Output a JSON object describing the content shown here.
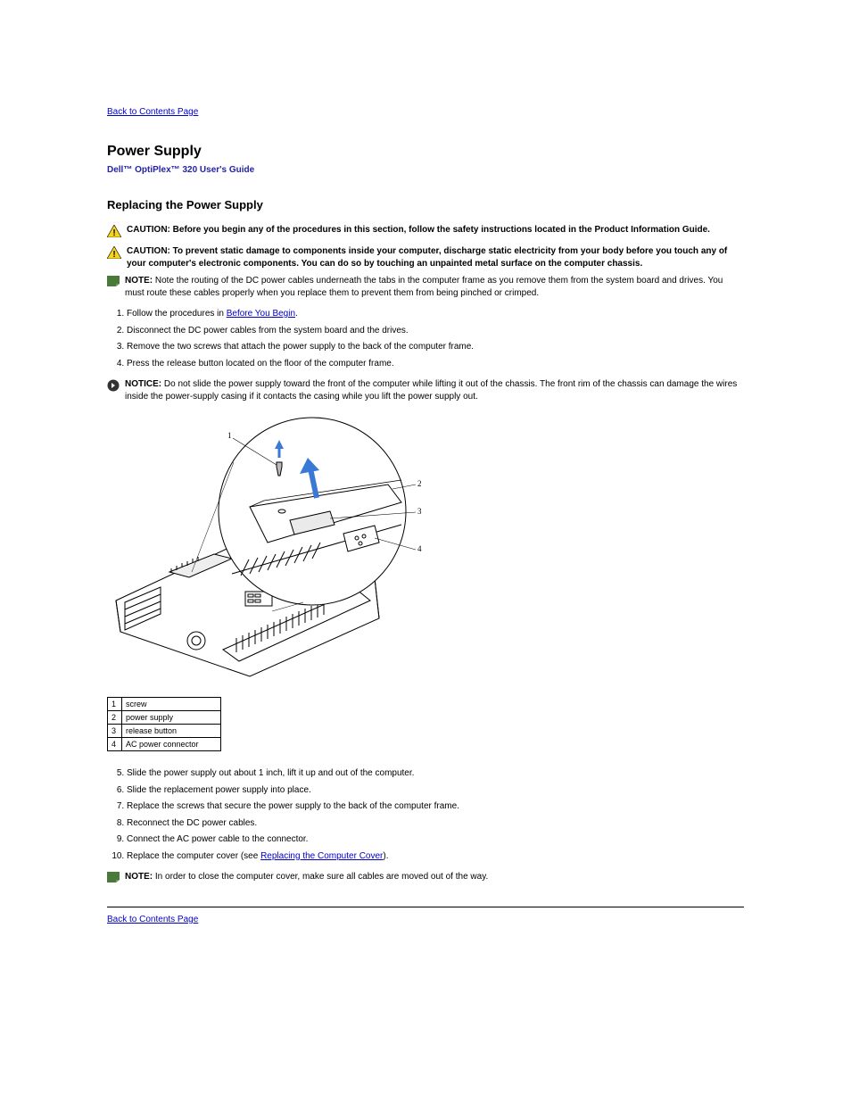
{
  "nav": {
    "back_top": "Back to Contents Page",
    "back_bottom": "Back to Contents Page"
  },
  "title": "Power Supply",
  "subtitle": "Dell™ OptiPlex™ 320 User's Guide",
  "replace": {
    "heading": "Replacing the Power Supply",
    "caution1": "CAUTION: Before you begin any of the procedures in this section, follow the safety instructions located in the Product Information Guide.",
    "caution2": "CAUTION: To prevent static damage to components inside your computer, discharge static electricity from your body before you touch any of your computer's electronic components. You can do so by touching an unpainted metal surface on the computer chassis.",
    "note1": "NOTE: Note the routing of the DC power cables underneath the tabs in the computer frame as you remove them from the system board and drives. You must route these cables properly when you replace them to prevent them from being pinched or crimped.",
    "steps_a": [
      {
        "text_before": "Follow the procedures in ",
        "link": "Before You Begin",
        "text_after": "."
      },
      {
        "text_before": "Disconnect the DC power cables from the system board and the drives."
      },
      {
        "text_before": "Remove the two screws that attach the power supply to the back of the computer frame."
      },
      {
        "text_before": "Press the release button located on the floor of the computer frame."
      }
    ],
    "notice1": "NOTICE: Do not slide the power supply toward the front of the computer while lifting it out of the chassis. The front rim of the chassis can damage the wires inside the power-supply casing if it contacts the casing while you lift the power supply out.",
    "diagram_labels": [
      {
        "n": "1",
        "label": "screw"
      },
      {
        "n": "2",
        "label": "power supply"
      },
      {
        "n": "3",
        "label": "release button"
      },
      {
        "n": "4",
        "label": "AC power connector"
      }
    ],
    "steps_b_start": 5,
    "steps_b": [
      {
        "text_before": "Slide the power supply out about 1 inch, lift it up and out of the computer."
      },
      {
        "text_before": "Slide the replacement power supply into place."
      },
      {
        "text_before": "Replace the screws that secure the power supply to the back of the computer frame."
      },
      {
        "text_before": "Reconnect the DC power cables."
      },
      {
        "text_before": "Connect the AC power cable to the connector."
      },
      {
        "text_before": "Replace the computer cover (see ",
        "link": "Replacing the Computer Cover",
        "text_after": ")."
      }
    ],
    "note2": "NOTE: In order to close the computer cover, make sure all cables are moved out of the way."
  }
}
